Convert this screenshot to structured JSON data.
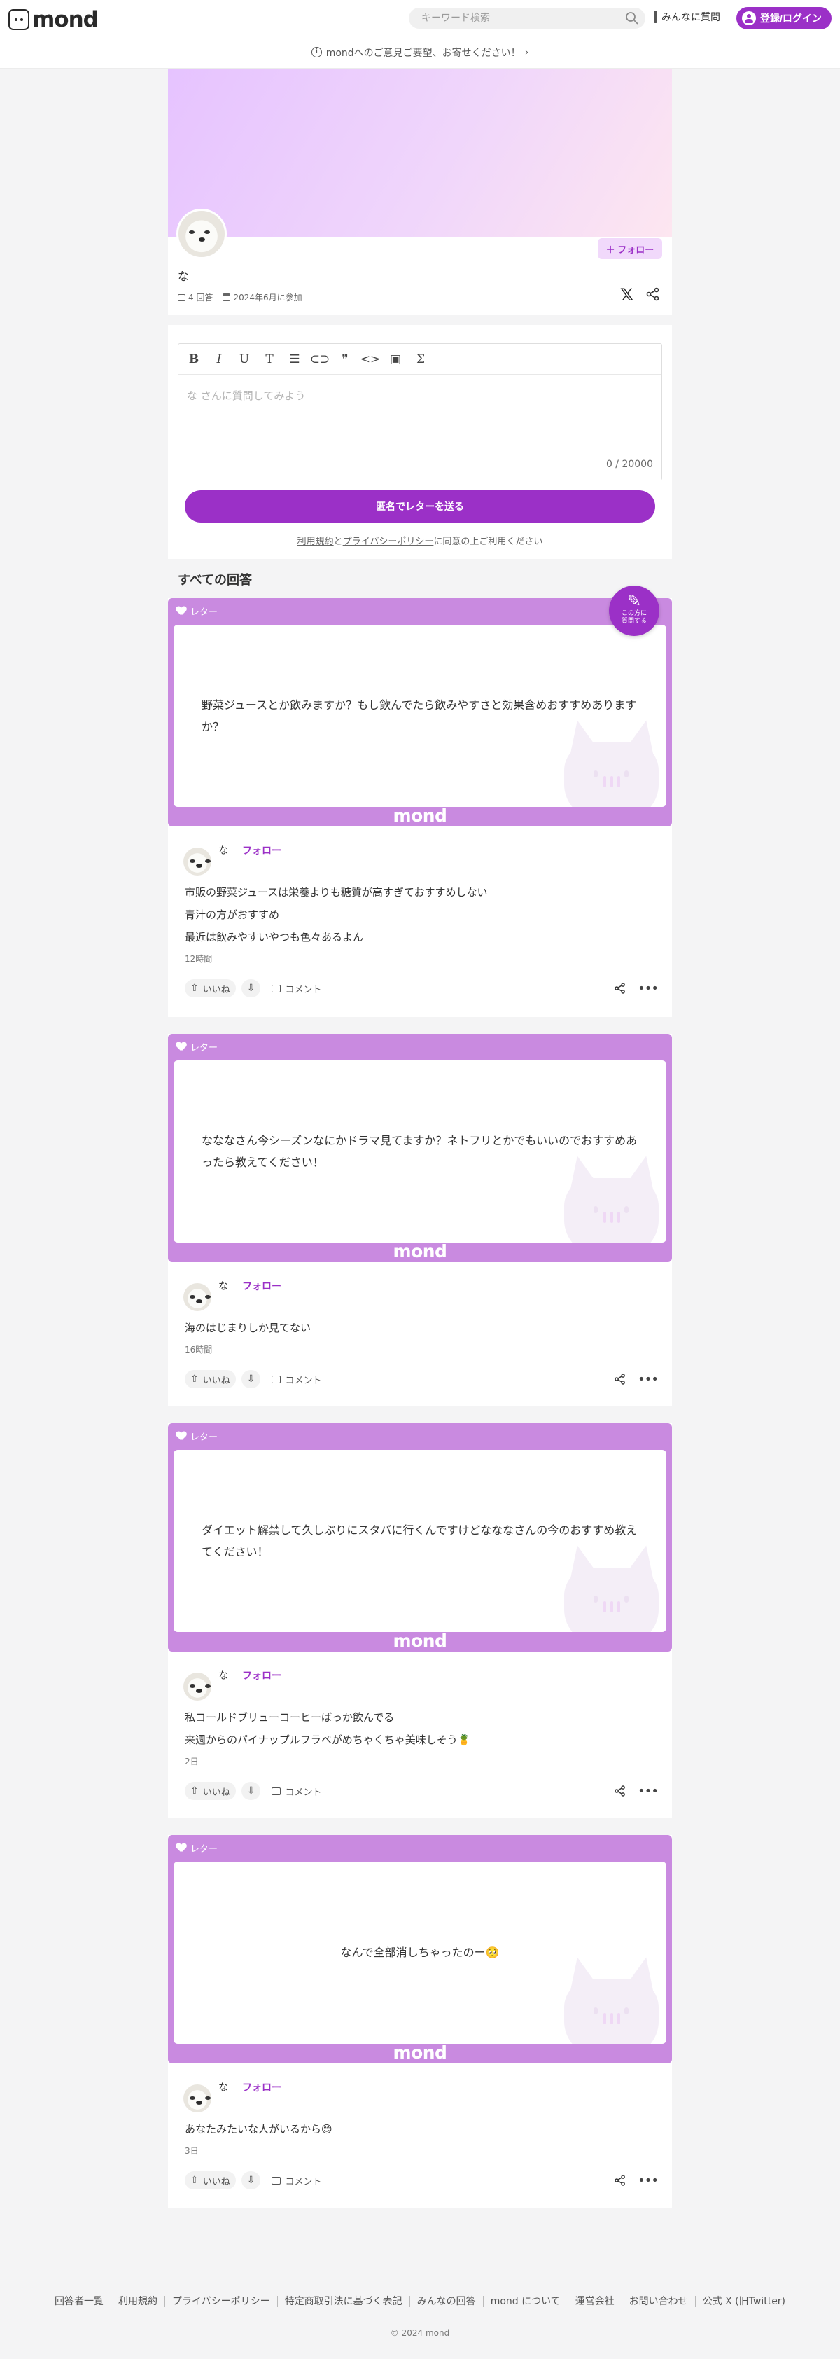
{
  "header": {
    "logo_text": "mond",
    "search_placeholder": "キーワード検索",
    "ask_label": "みんなに質問",
    "login_label": "登録/ログイン"
  },
  "feedback_bar": {
    "text": "mondへのご意見ご要望、お寄せください！"
  },
  "profile": {
    "name": "な",
    "follow_label": "フォロー",
    "answers_count": "4 回答",
    "joined": "2024年6月に参加"
  },
  "question_form": {
    "toolbar": [
      "bold-icon",
      "italic-icon",
      "underline-icon",
      "strikethrough-icon",
      "bulleted-list-icon",
      "link-icon",
      "quote-icon",
      "code-icon",
      "image-icon",
      "formula-icon"
    ],
    "placeholder": "な さんに質問してみよう",
    "counter": "0 / 20000",
    "send_label": "匿名でレターを送る",
    "terms_link": "利用規約",
    "and": "と",
    "privacy_link": "プライバシーポリシー",
    "terms_suffix": "に同意の上ご利用ください"
  },
  "section_title": "すべての回答",
  "fab": {
    "line1": "この方に",
    "line2": "質問する"
  },
  "letter_label": "レター",
  "letter_brand": "mond",
  "actions": {
    "like": "いいね",
    "comment": "コメント"
  },
  "answers": [
    {
      "question": "野菜ジュースとか飲みますか？もし飲んでたら飲みやすさと効果含めおすすめありますか？",
      "user": "な",
      "follow": "フォロー",
      "lines": [
        "市販の野菜ジュースは栄養よりも糖質が高すぎておすすめしない",
        "青汁の方がおすすめ",
        "最近は飲みやすいやつも色々あるよん"
      ],
      "time": "12時間"
    },
    {
      "question": "なななさん今シーズンなにかドラマ見てますか？ネトフリとかでもいいのでおすすめあったら教えてください！",
      "user": "な",
      "follow": "フォロー",
      "lines": [
        "海のはじまりしか見てない"
      ],
      "time": "16時間"
    },
    {
      "question": "ダイエット解禁して久しぶりにスタバに行くんですけどなななさんの今のおすすめ教えてください！",
      "user": "な",
      "follow": "フォロー",
      "lines": [
        "私コールドブリューコーヒーばっか飲んでる",
        "来週からのパイナップルフラペがめちゃくちゃ美味しそう🍍"
      ],
      "time": "2日"
    },
    {
      "question": "なんで全部消しちゃったのー🥺",
      "user": "な",
      "follow": "フォロー",
      "lines": [
        "あなたみたいな人がいるから😊"
      ],
      "time": "3日"
    }
  ],
  "footer": {
    "links": [
      "回答者一覧",
      "利用規約",
      "プライバシーポリシー",
      "特定商取引法に基づく表記",
      "みんなの回答",
      "mond について",
      "運営会社",
      "お問い合わせ",
      "公式 X (旧Twitter)"
    ],
    "copyright": "© 2024 mond"
  },
  "colors": {
    "accent": "#9b30c7",
    "letter_bg": "#c98ae0",
    "follow_bg": "#f1d9fb"
  }
}
